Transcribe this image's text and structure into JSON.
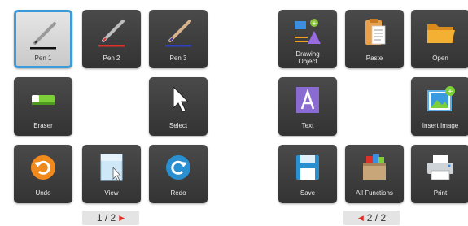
{
  "left_page": {
    "tiles": [
      {
        "label": "Pen 1",
        "icon": "pen-icon",
        "selected": true
      },
      {
        "label": "Pen 2",
        "icon": "pen-icon"
      },
      {
        "label": "Pen 3",
        "icon": "pen-icon"
      },
      {
        "label": "Eraser",
        "icon": "eraser-icon"
      },
      {
        "label": "Select",
        "icon": "cursor-icon"
      },
      {
        "label": "Undo",
        "icon": "undo-icon"
      },
      {
        "label": "View",
        "icon": "view-icon"
      },
      {
        "label": "Redo",
        "icon": "redo-icon"
      }
    ],
    "pager": {
      "text": "1 / 2",
      "arrow": "▶"
    }
  },
  "right_page": {
    "tiles": [
      {
        "label": "Drawing Object",
        "line1": "Drawing",
        "line2": "Object",
        "icon": "drawing-object-icon"
      },
      {
        "label": "Paste",
        "icon": "clipboard-icon"
      },
      {
        "label": "Open",
        "icon": "folder-icon"
      },
      {
        "label": "Text",
        "icon": "text-icon"
      },
      {
        "label": "Insert Image",
        "icon": "image-icon"
      },
      {
        "label": "Save",
        "icon": "floppy-disk-icon"
      },
      {
        "label": "All Functions",
        "icon": "all-functions-icon"
      },
      {
        "label": "Print",
        "icon": "printer-icon"
      }
    ],
    "pager": {
      "text": "2 / 2",
      "arrow": "◀"
    }
  },
  "colors": {
    "tile_bg": "#3a3a3a",
    "selected_border": "#3f9bd8",
    "pen1_line": "#111111",
    "pen2_line": "#e0302a",
    "pen3_line": "#2f3fbf",
    "undo_orange": "#f08a1c",
    "redo_blue": "#2a8fd0",
    "text_purple": "#8a6bd1",
    "pager_arrow": "#e0302a"
  }
}
